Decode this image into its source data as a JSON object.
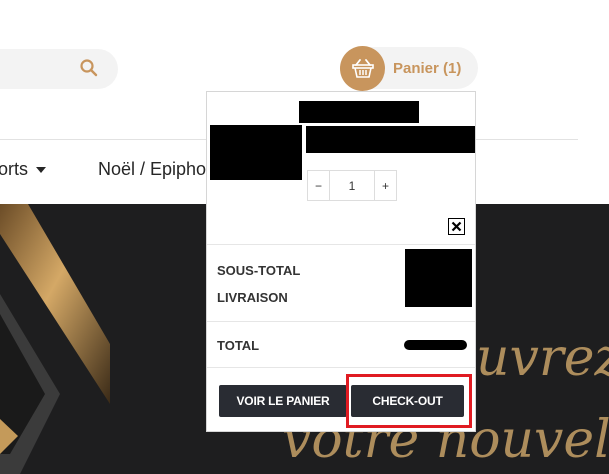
{
  "header": {
    "cart_label": "Panier (1)"
  },
  "nav": {
    "items": [
      "orts",
      "Noël / Epipho"
    ]
  },
  "hero": {
    "line1": "uvrez",
    "line2": "votre nouvel"
  },
  "cart_dropdown": {
    "item": {
      "quantity": "1",
      "minus": "−",
      "plus": "+"
    },
    "subtotal_label": "SOUS-TOTAL",
    "shipping_label": "LIVRAISON",
    "total_label": "TOTAL",
    "view_cart_label": "VOIR LE PANIER",
    "checkout_label": "CHECK-OUT"
  },
  "colors": {
    "accent": "#c8955d",
    "hero_bg": "#1e1e1f",
    "button_bg": "#292c33",
    "highlight": "#e01b22"
  }
}
